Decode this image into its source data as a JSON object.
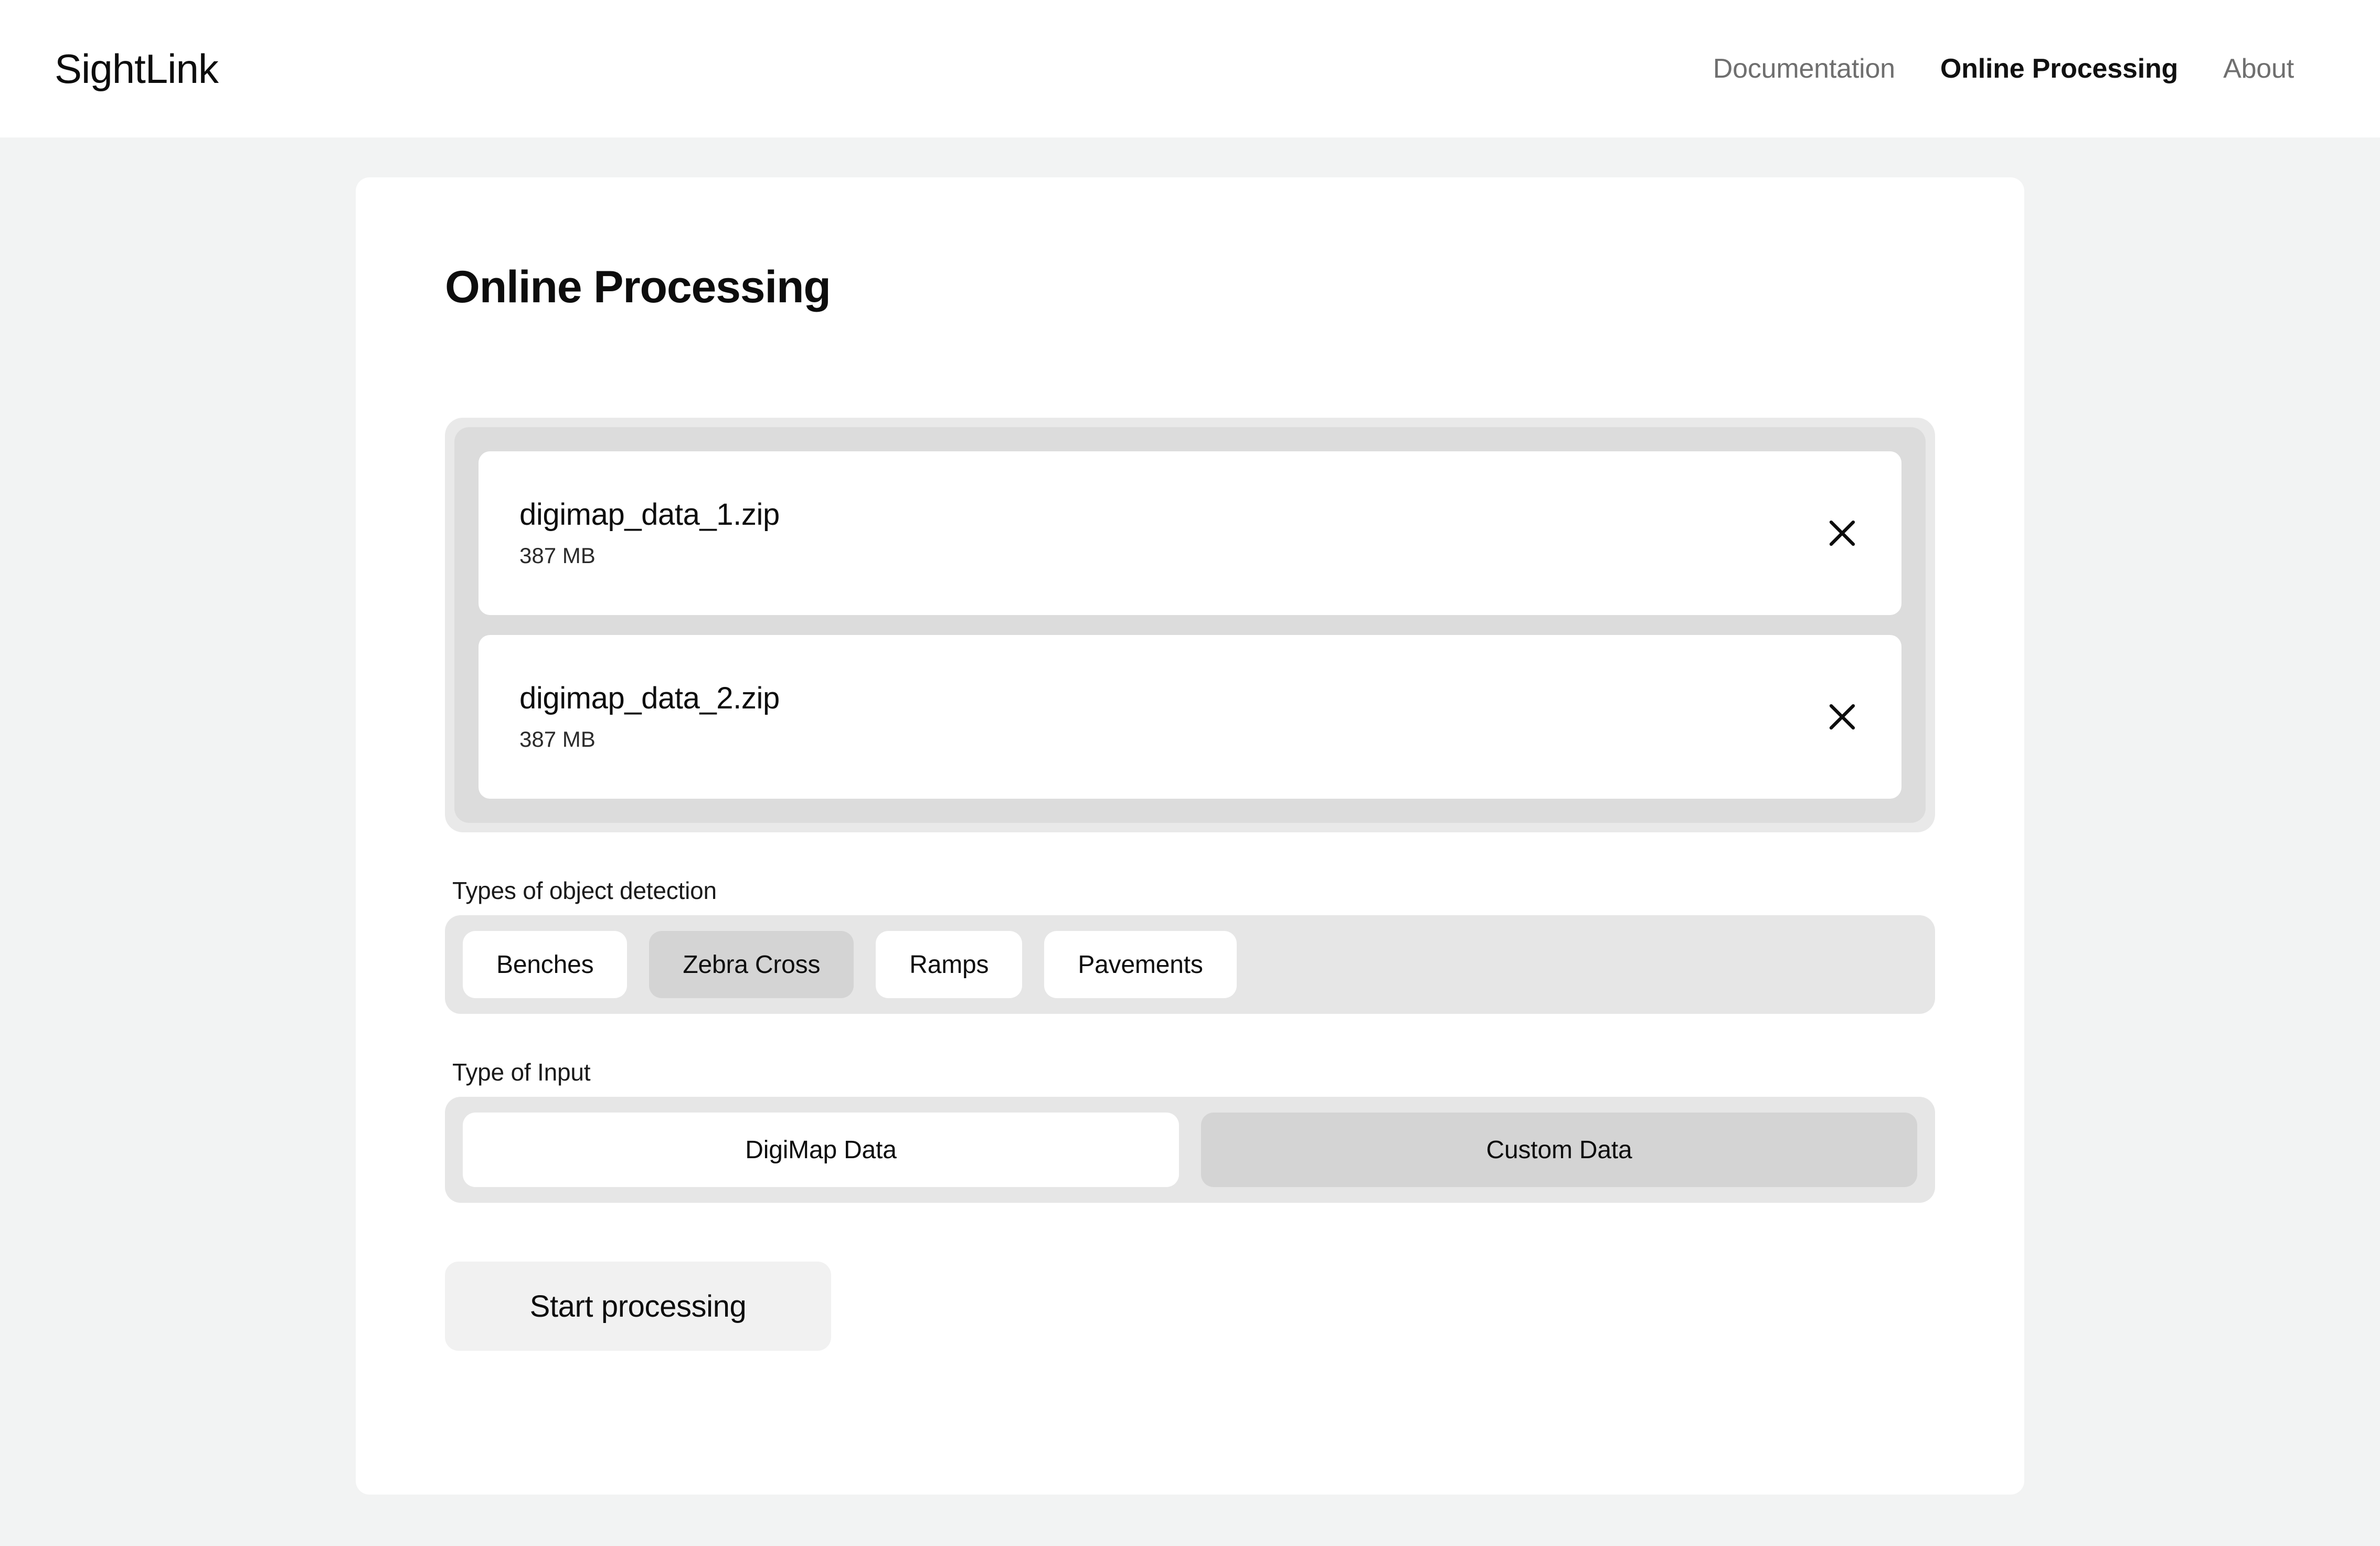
{
  "header": {
    "brand": "SightLink",
    "nav": [
      {
        "label": "Documentation",
        "active": false
      },
      {
        "label": "Online Processing",
        "active": true
      },
      {
        "label": "About",
        "active": false
      }
    ]
  },
  "main": {
    "title": "Online Processing",
    "files": [
      {
        "name": "digimap_data_1.zip",
        "size": "387 MB",
        "remove_icon": "close-icon"
      },
      {
        "name": "digimap_data_2.zip",
        "size": "387 MB",
        "remove_icon": "close-icon"
      }
    ],
    "detection": {
      "label": "Types of object detection",
      "options": [
        {
          "label": "Benches",
          "selected": false
        },
        {
          "label": "Zebra Cross",
          "selected": true
        },
        {
          "label": "Ramps",
          "selected": false
        },
        {
          "label": "Pavements",
          "selected": false
        }
      ]
    },
    "input_type": {
      "label": "Type of Input",
      "options": [
        {
          "label": "DigiMap Data",
          "selected": false
        },
        {
          "label": "Custom Data",
          "selected": true
        }
      ]
    },
    "start_button": "Start processing"
  },
  "colors": {
    "page_background": "#f2f3f3",
    "card_background": "#ffffff",
    "dropzone_outer": "#e9e9e9",
    "dropzone_inner": "#dcdcdc",
    "track": "#e6e6e6",
    "selected": "#d4d4d4",
    "button": "#f1f1f1",
    "text": "#0d0d0d",
    "muted_text": "#6f6f6f"
  }
}
